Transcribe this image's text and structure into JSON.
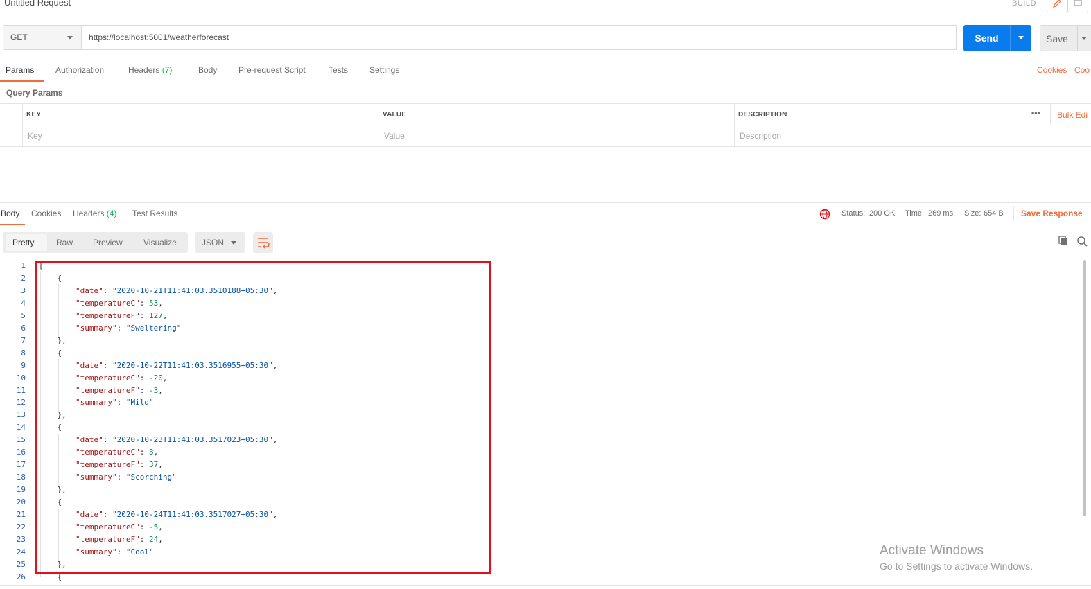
{
  "header": {
    "title": "Untitled Request",
    "build_label": "BUILD"
  },
  "request": {
    "method": "GET",
    "url": "https://localhost:5001/weatherforecast",
    "send_label": "Send",
    "save_label": "Save"
  },
  "request_tabs": {
    "params": "Params",
    "authorization": "Authorization",
    "headers": "Headers",
    "headers_count": "(7)",
    "body": "Body",
    "prerequest": "Pre-request Script",
    "tests": "Tests",
    "settings": "Settings",
    "cookies": "Cookies",
    "code": "Coo"
  },
  "query_params": {
    "section_label": "Query Params",
    "col_key": "KEY",
    "col_value": "VALUE",
    "col_description": "DESCRIPTION",
    "bulk_edit": "Bulk Edi",
    "placeholder_key": "Key",
    "placeholder_value": "Value",
    "placeholder_description": "Description",
    "more": "•••"
  },
  "response_tabs": {
    "body": "Body",
    "cookies": "Cookies",
    "headers": "Headers",
    "headers_count": "(4)",
    "test_results": "Test Results"
  },
  "response_status": {
    "status_label": "Status:",
    "status_value": "200 OK",
    "time_label": "Time:",
    "time_value": "269 ms",
    "size_label": "Size:",
    "size_value": "654 B",
    "save_response": "Save Response"
  },
  "format_bar": {
    "pretty": "Pretty",
    "raw": "Raw",
    "preview": "Preview",
    "visualize": "Visualize",
    "format": "JSON"
  },
  "code_lines": [
    {
      "n": "1",
      "html": "["
    },
    {
      "n": "2",
      "html": "    {"
    },
    {
      "n": "3",
      "html": "        <span class='k'>\"date\"</span>: <span class='s'>\"2020-10-21T11:41:03.3510188+05:30\"</span>,"
    },
    {
      "n": "4",
      "html": "        <span class='k'>\"temperatureC\"</span>: <span class='n'>53</span>,"
    },
    {
      "n": "5",
      "html": "        <span class='k'>\"temperatureF\"</span>: <span class='n'>127</span>,"
    },
    {
      "n": "6",
      "html": "        <span class='k'>\"summary\"</span>: <span class='s'>\"Sweltering\"</span>"
    },
    {
      "n": "7",
      "html": "    },"
    },
    {
      "n": "8",
      "html": "    {"
    },
    {
      "n": "9",
      "html": "        <span class='k'>\"date\"</span>: <span class='s'>\"2020-10-22T11:41:03.3516955+05:30\"</span>,"
    },
    {
      "n": "10",
      "html": "        <span class='k'>\"temperatureC\"</span>: <span class='n'>-20</span>,"
    },
    {
      "n": "11",
      "html": "        <span class='k'>\"temperatureF\"</span>: <span class='n'>-3</span>,"
    },
    {
      "n": "12",
      "html": "        <span class='k'>\"summary\"</span>: <span class='s'>\"Mild\"</span>"
    },
    {
      "n": "13",
      "html": "    },"
    },
    {
      "n": "14",
      "html": "    {"
    },
    {
      "n": "15",
      "html": "        <span class='k'>\"date\"</span>: <span class='s'>\"2020-10-23T11:41:03.3517023+05:30\"</span>,"
    },
    {
      "n": "16",
      "html": "        <span class='k'>\"temperatureC\"</span>: <span class='n'>3</span>,"
    },
    {
      "n": "17",
      "html": "        <span class='k'>\"temperatureF\"</span>: <span class='n'>37</span>,"
    },
    {
      "n": "18",
      "html": "        <span class='k'>\"summary\"</span>: <span class='s'>\"Scorching\"</span>"
    },
    {
      "n": "19",
      "html": "    },"
    },
    {
      "n": "20",
      "html": "    {"
    },
    {
      "n": "21",
      "html": "        <span class='k'>\"date\"</span>: <span class='s'>\"2020-10-24T11:41:03.3517027+05:30\"</span>,"
    },
    {
      "n": "22",
      "html": "        <span class='k'>\"temperatureC\"</span>: <span class='n'>-5</span>,"
    },
    {
      "n": "23",
      "html": "        <span class='k'>\"temperatureF\"</span>: <span class='n'>24</span>,"
    },
    {
      "n": "24",
      "html": "        <span class='k'>\"summary\"</span>: <span class='s'>\"Cool\"</span>"
    },
    {
      "n": "25",
      "html": "    },"
    },
    {
      "n": "26",
      "html": "    {"
    }
  ],
  "watermark": {
    "line1": "Activate Windows",
    "line2": "Go to Settings to activate Windows."
  },
  "colors": {
    "accent": "#f26b3a",
    "send": "#097bed",
    "success": "#0cbb52",
    "highlight": "#e0101d"
  },
  "icons": [
    "pencil-icon",
    "comment-icon",
    "globe-error-icon",
    "wrap-lines-icon",
    "copy-icon",
    "search-icon"
  ]
}
